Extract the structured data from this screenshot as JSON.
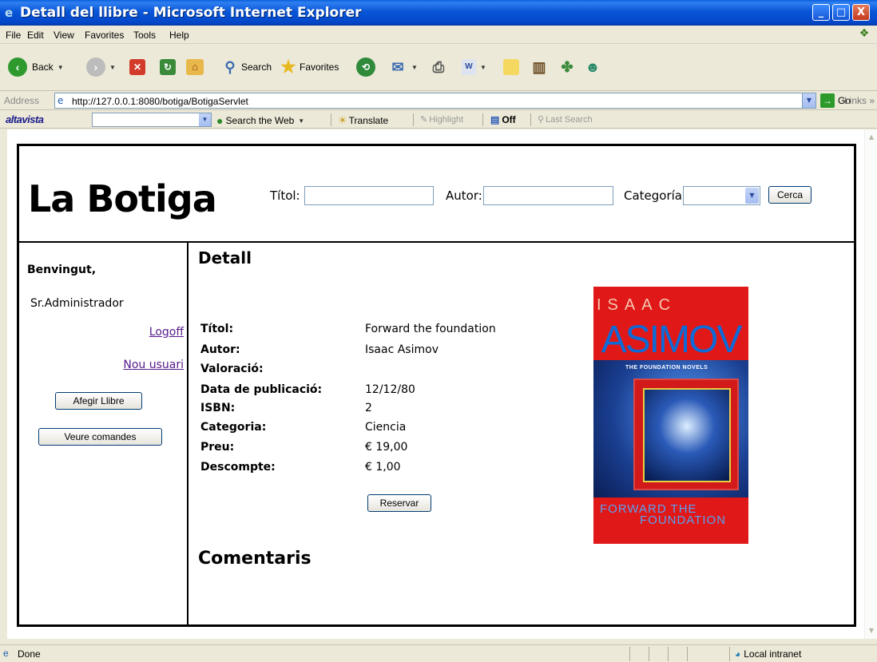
{
  "window": {
    "title": "Detall del llibre - Microsoft Internet Explorer",
    "controls": {
      "minimize": "_",
      "maximize": "□",
      "close": "X"
    }
  },
  "menu": [
    "File",
    "Edit",
    "View",
    "Favorites",
    "Tools",
    "Help"
  ],
  "toolbar": {
    "back": "Back",
    "search": "Search",
    "favorites": "Favorites"
  },
  "address": {
    "label": "Address",
    "url": "http://127.0.0.1:8080/botiga/BotigaServlet",
    "go": "Go",
    "links": "Links"
  },
  "altavista": {
    "logo": "altavista",
    "search_web": "Search the Web",
    "translate": "Translate",
    "highlight": "Highlight",
    "off": "Off",
    "last_search": "Last Search"
  },
  "header": {
    "brand": "La Botiga",
    "titol_label": "Títol:",
    "autor_label": "Autor:",
    "categoria_label": "Categoría:",
    "search_button": "Cerca"
  },
  "sidebar": {
    "welcome": "Benvingut,",
    "user": "Sr.Administrador",
    "logoff": "Logoff",
    "new_user": "Nou usuari",
    "add_book": "Afegir Llibre",
    "view_orders": "Veure comandes"
  },
  "detail": {
    "heading": "Detall",
    "fields": [
      {
        "label": "Títol:",
        "value": "Forward the foundation"
      },
      {
        "label": "Autor:",
        "value": "Isaac Asimov"
      },
      {
        "label": "Valoració:",
        "value": ""
      },
      {
        "label": "Data de publicació:",
        "value": "12/12/80"
      },
      {
        "label": "ISBN:",
        "value": "2"
      },
      {
        "label": "Categoria:",
        "value": "Ciencia"
      },
      {
        "label": "Preu:",
        "value": "€ 19,00"
      },
      {
        "label": "Descompte:",
        "value": "€ 1,00"
      }
    ],
    "reserve_button": "Reservar",
    "comments_heading": "Comentaris"
  },
  "cover": {
    "author_first": "ISAAC",
    "author_last": "ASIMOV",
    "series": "THE FOUNDATION NOVELS",
    "title_line1": "FORWARD THE",
    "title_line2": "FOUNDATION"
  },
  "status": {
    "text": "Done",
    "zone": "Local intranet"
  }
}
